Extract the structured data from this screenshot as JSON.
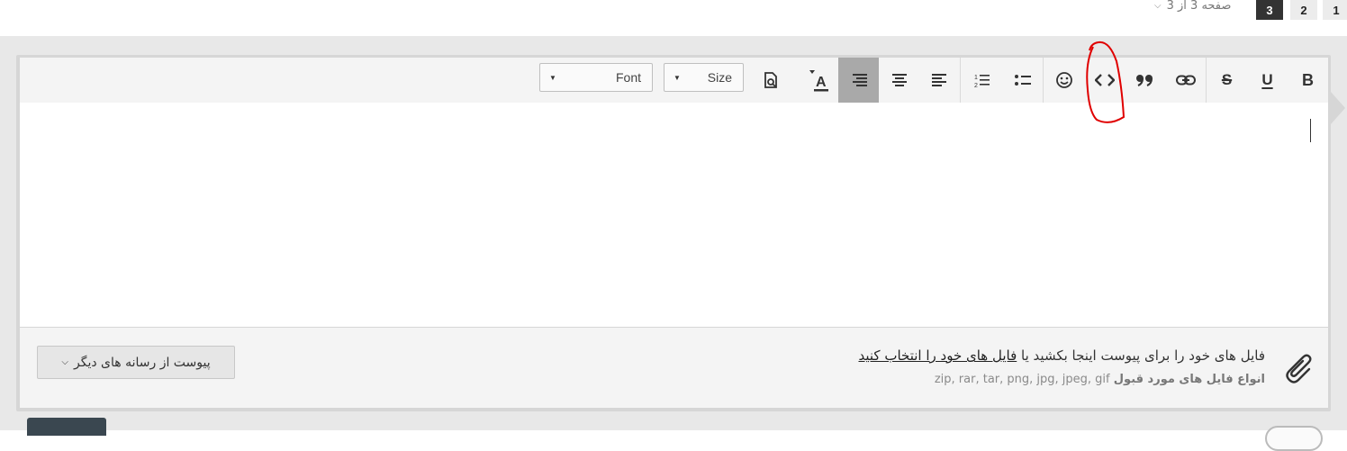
{
  "pagination": {
    "pages": [
      "1",
      "2",
      "3"
    ],
    "current": "3",
    "label": "صفحه 3 از 3"
  },
  "toolbar": {
    "font_label": "Font",
    "size_label": "Size",
    "bold_label": "B",
    "underline_label": "U",
    "strike_label": "S",
    "text_color_label": "A",
    "buttons": [
      "bold",
      "underline",
      "strikethrough",
      "link",
      "quote",
      "code",
      "smilie",
      "unordered-list",
      "ordered-list",
      "align-left",
      "align-center",
      "align-right",
      "text-color",
      "preview",
      "size",
      "font"
    ],
    "active_button": "align-right"
  },
  "attachments": {
    "prompt_prefix": "فایل های خود را برای پیوست اینجا بکشید یا",
    "prompt_link": "فایل های خود را انتخاب کنید",
    "types_label": "انواع فایل های مورد قبول",
    "types_value": "zip, rar, tar, png, jpg, jpeg, gif",
    "media_button": "پیوست از رسانه های دیگر"
  },
  "colors": {
    "annotation": "#e00000",
    "active_page": "#333333",
    "active_tool": "#a9a9a9"
  }
}
